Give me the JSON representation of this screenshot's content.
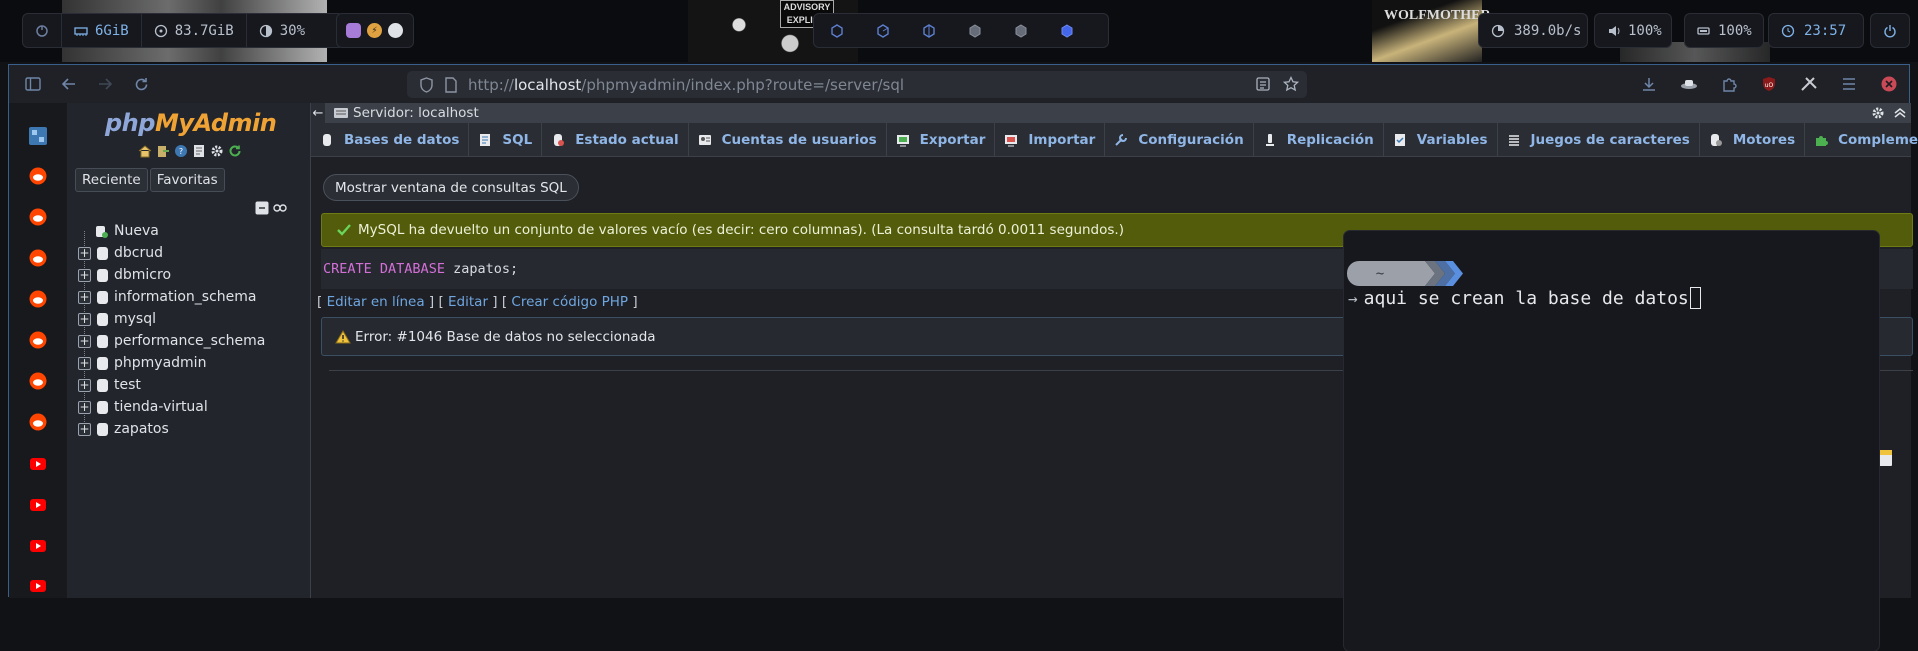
{
  "system_bar": {
    "mem_used": "6GiB",
    "disk": "83.7GiB",
    "cpu": "30%",
    "network": "389.0b/s",
    "volume": "100%",
    "battery": "100%",
    "clock": "23:57",
    "wallpaper_text_1": "ADVISORY",
    "wallpaper_text_2": "EXPLICIT",
    "wallpaper_text_3": "WOLFMOTHER"
  },
  "browser": {
    "url_prefix": "http://",
    "url_host": "localhost",
    "url_path": "/phpmyadmin/index.php?route=/server/sql"
  },
  "pma_nav": {
    "logo_php": "php",
    "logo_my": "MyAdmin",
    "tab_recent": "Reciente",
    "tab_favorites": "Favoritas",
    "new_label": "Nueva",
    "databases": [
      "dbcrud",
      "dbmicro",
      "information_schema",
      "mysql",
      "performance_schema",
      "phpmyadmin",
      "test",
      "tienda-virtual",
      "zapatos"
    ]
  },
  "server_bar": {
    "label": "Servidor: localhost"
  },
  "tabs": [
    {
      "label": "Bases de datos",
      "icon": "database-icon"
    },
    {
      "label": "SQL",
      "icon": "sql-icon"
    },
    {
      "label": "Estado actual",
      "icon": "status-icon"
    },
    {
      "label": "Cuentas de usuarios",
      "icon": "users-icon"
    },
    {
      "label": "Exportar",
      "icon": "export-icon"
    },
    {
      "label": "Importar",
      "icon": "import-icon"
    },
    {
      "label": "Configuración",
      "icon": "wrench-icon"
    },
    {
      "label": "Replicación",
      "icon": "replication-icon"
    },
    {
      "label": "Variables",
      "icon": "variables-icon"
    },
    {
      "label": "Juegos de caracteres",
      "icon": "charset-icon"
    },
    {
      "label": "Motores",
      "icon": "engines-icon"
    },
    {
      "label": "Complementos",
      "icon": "plugin-icon"
    }
  ],
  "content": {
    "show_sql_button": "Mostrar ventana de consultas SQL",
    "success_message": "MySQL ha devuelto un conjunto de valores vacío (es decir: cero columnas). (La consulta tardó 0.0011 segundos.)",
    "sql_kw1": "CREATE",
    "sql_kw2": "DATABASE",
    "sql_rest": "zapatos;",
    "link_inline_edit": "Editar en línea",
    "link_edit": "Editar",
    "link_php": "Crear código PHP",
    "error_message": "Error: #1046 Base de datos no seleccionada"
  },
  "terminal": {
    "prompt_dir": "~",
    "command": "aqui se crean la base de datos"
  },
  "colors": {
    "success_bg": "#525c0a",
    "link": "#6fa6e0",
    "tab_text": "#8fb6e6",
    "sql_keyword": "#d46fd8",
    "accent_blue": "#3a5f8a"
  }
}
